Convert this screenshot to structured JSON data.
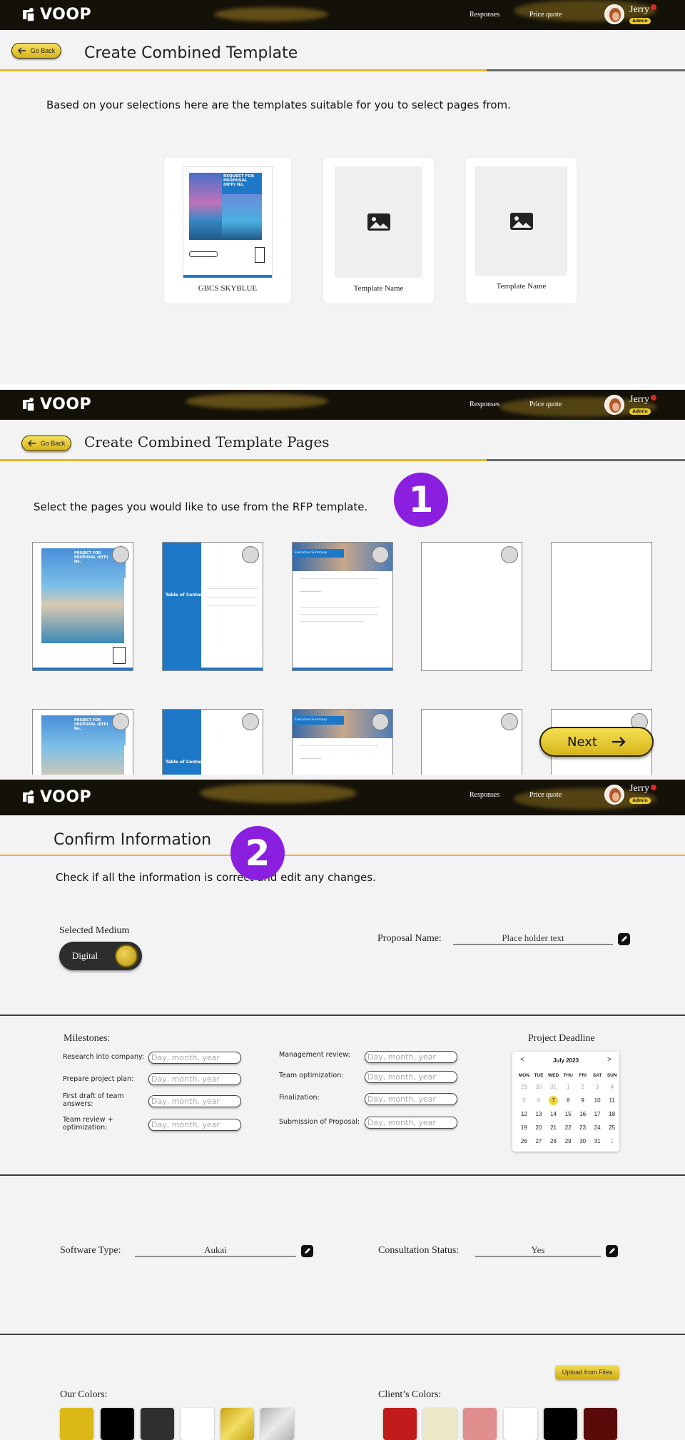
{
  "header": {
    "logo_text": "VOOP",
    "nav": [
      "Responses",
      "Price quote"
    ],
    "user": {
      "name": "Jerry",
      "role": "Admin"
    }
  },
  "screen1": {
    "go_back": "Go Back",
    "title": "Create Combined Template",
    "description": "Based on your selections here are the templates suitable for you to select pages from.",
    "templates": [
      {
        "name": "GBCS SKYBLUE",
        "cover_heading": "REQUEST FOR PROPOSAL (RFP) No."
      },
      {
        "name": "Template Name"
      },
      {
        "name": "Template Name"
      }
    ]
  },
  "screen2": {
    "go_back": "Go Back",
    "title": "Create Combined Template Pages",
    "description": "Select the pages you would like to use from the RFP template.",
    "step": "1",
    "page_labels": {
      "cover": "PROJECT FOR PROPOSAL (RFP) No.",
      "toc": "Table of Contents",
      "exec": "Executive Summary"
    },
    "next_button": "Next"
  },
  "screen3": {
    "title": "Confirm Information",
    "step": "2",
    "description": "Check if all the information is correct and edit any changes.",
    "selected_medium": {
      "label": "Selected Medium",
      "value": "Digital"
    },
    "proposal_name": {
      "label": "Proposal Name:",
      "value": "Place holder text"
    },
    "milestones": {
      "title": "Milestones:",
      "placeholder": "Day, month, year",
      "left": [
        "Research into company:",
        "Prepare project plan:",
        "First draft of team answers:",
        "Team review + optimization:"
      ],
      "right": [
        "Management review:",
        "Team optimization:",
        "Finalization:",
        "Submission of Proposal:"
      ]
    },
    "deadline": {
      "title": "Project Deadline",
      "month": "July 2023",
      "prev": "<",
      "next": ">",
      "days": [
        "MON",
        "TUE",
        "WED",
        "THU",
        "FRI",
        "SAT",
        "SUN"
      ],
      "weeks": [
        [
          "29",
          "30",
          "31",
          "1",
          "2",
          "3",
          "4"
        ],
        [
          "5",
          "6",
          "7",
          "8",
          "9",
          "10",
          "11"
        ],
        [
          "12",
          "13",
          "14",
          "15",
          "16",
          "17",
          "18"
        ],
        [
          "19",
          "20",
          "21",
          "22",
          "23",
          "24",
          "25"
        ],
        [
          "26",
          "27",
          "28",
          "29",
          "30",
          "31",
          "1"
        ]
      ],
      "selected": "7"
    },
    "software_type": {
      "label": "Software Type:",
      "value": "Aukai"
    },
    "consultation_status": {
      "label": "Consultation Status:",
      "value": "Yes"
    },
    "upload_button": "Upload from Files",
    "our_colors": {
      "label": "Our Colors:",
      "swatches": [
        "#dcb817",
        "#000000",
        "#2f2f2f",
        "#ffffff",
        "#d6b51a",
        "#c9c9c9"
      ]
    },
    "client_colors": {
      "label": "Client’s Colors:",
      "swatches": [
        "#c21b1b",
        "#ede8c8",
        "#e08e8e",
        "#ffffff",
        "#000000",
        "#5b0a0a"
      ]
    }
  }
}
